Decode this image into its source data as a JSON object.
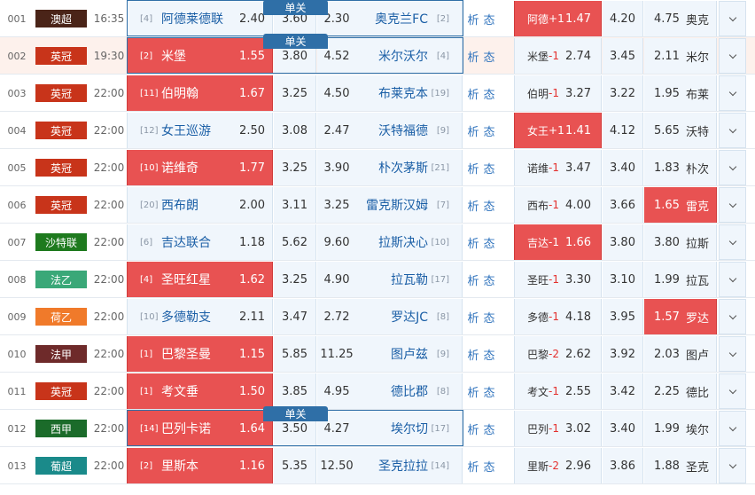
{
  "tag_label": "单关",
  "colors": {
    "highlight": "#e85252",
    "handicap_text": "#e3312f",
    "link": "#2f73bd",
    "team": "#1b5fa6",
    "single_box": "#2f6fa7"
  },
  "rows": [
    {
      "num": "001",
      "league": "澳超",
      "league_color": "#4a2418",
      "time": "16:35",
      "home_rank": "[4]",
      "home": "阿德莱德联",
      "home_odds": "2.40",
      "draw": "3.60",
      "away_odds": "2.30",
      "away": "奥克兰FC",
      "away_rank": "[2]",
      "analysis": "析",
      "state": "态",
      "hc_team": "阿德",
      "hc": "+1",
      "hc_home": "1.47",
      "hc_draw": "4.20",
      "hc_away": "4.75",
      "hc_away_team": "奥克",
      "single": true,
      "row_hl": false,
      "home_red": false,
      "hc_home_red": true,
      "hc_away_red": false
    },
    {
      "num": "002",
      "league": "英冠",
      "league_color": "#c8341a",
      "time": "19:30",
      "home_rank": "[2]",
      "home": "米堡",
      "home_odds": "1.55",
      "draw": "3.80",
      "away_odds": "4.52",
      "away": "米尔沃尔",
      "away_rank": "[4]",
      "analysis": "析",
      "state": "态",
      "hc_team": "米堡",
      "hc": "-1",
      "hc_home": "2.74",
      "hc_draw": "3.45",
      "hc_away": "2.11",
      "hc_away_team": "米尔",
      "single": true,
      "row_hl": true,
      "home_red": true,
      "hc_home_red": false,
      "hc_away_red": false
    },
    {
      "num": "003",
      "league": "英冠",
      "league_color": "#c8341a",
      "time": "22:00",
      "home_rank": "[11]",
      "home": "伯明翰",
      "home_odds": "1.67",
      "draw": "3.25",
      "away_odds": "4.50",
      "away": "布莱克本",
      "away_rank": "[19]",
      "analysis": "析",
      "state": "态",
      "hc_team": "伯明",
      "hc": "-1",
      "hc_home": "3.27",
      "hc_draw": "3.22",
      "hc_away": "1.95",
      "hc_away_team": "布莱",
      "single": false,
      "row_hl": false,
      "home_red": true,
      "hc_home_red": false,
      "hc_away_red": false
    },
    {
      "num": "004",
      "league": "英冠",
      "league_color": "#c8341a",
      "time": "22:00",
      "home_rank": "[12]",
      "home": "女王巡游",
      "home_odds": "2.50",
      "draw": "3.08",
      "away_odds": "2.47",
      "away": "沃特福德",
      "away_rank": "[9]",
      "analysis": "析",
      "state": "态",
      "hc_team": "女王",
      "hc": "+1",
      "hc_home": "1.41",
      "hc_draw": "4.12",
      "hc_away": "5.65",
      "hc_away_team": "沃特",
      "single": false,
      "row_hl": false,
      "home_red": false,
      "hc_home_red": true,
      "hc_away_red": false
    },
    {
      "num": "005",
      "league": "英冠",
      "league_color": "#c8341a",
      "time": "22:00",
      "home_rank": "[10]",
      "home": "诺维奇",
      "home_odds": "1.77",
      "draw": "3.25",
      "away_odds": "3.90",
      "away": "朴次茅斯",
      "away_rank": "[21]",
      "analysis": "析",
      "state": "态",
      "hc_team": "诺维",
      "hc": "-1",
      "hc_home": "3.47",
      "hc_draw": "3.40",
      "hc_away": "1.83",
      "hc_away_team": "朴次",
      "single": false,
      "row_hl": false,
      "home_red": true,
      "hc_home_red": false,
      "hc_away_red": false
    },
    {
      "num": "006",
      "league": "英冠",
      "league_color": "#c8341a",
      "time": "22:00",
      "home_rank": "[20]",
      "home": "西布朗",
      "home_odds": "2.00",
      "draw": "3.11",
      "away_odds": "3.25",
      "away": "雷克斯汉姆",
      "away_rank": "[7]",
      "analysis": "析",
      "state": "态",
      "hc_team": "西布",
      "hc": "-1",
      "hc_home": "4.00",
      "hc_draw": "3.66",
      "hc_away": "1.65",
      "hc_away_team": "雷克",
      "single": false,
      "row_hl": false,
      "home_red": false,
      "hc_home_red": false,
      "hc_away_red": true
    },
    {
      "num": "007",
      "league": "沙特联",
      "league_color": "#1e7a1e",
      "time": "22:00",
      "home_rank": "[6]",
      "home": "吉达联合",
      "home_odds": "1.18",
      "draw": "5.62",
      "away_odds": "9.60",
      "away": "拉斯决心",
      "away_rank": "[10]",
      "analysis": "析",
      "state": "态",
      "hc_team": "吉达",
      "hc": "-1",
      "hc_home": "1.66",
      "hc_draw": "3.80",
      "hc_away": "3.80",
      "hc_away_team": "拉斯",
      "single": false,
      "row_hl": false,
      "home_red": false,
      "hc_home_red": true,
      "hc_away_red": false
    },
    {
      "num": "008",
      "league": "法乙",
      "league_color": "#3aa878",
      "time": "22:00",
      "home_rank": "[4]",
      "home": "圣旺红星",
      "home_odds": "1.62",
      "draw": "3.25",
      "away_odds": "4.90",
      "away": "拉瓦勒",
      "away_rank": "[17]",
      "analysis": "析",
      "state": "态",
      "hc_team": "圣旺",
      "hc": "-1",
      "hc_home": "3.30",
      "hc_draw": "3.10",
      "hc_away": "1.99",
      "hc_away_team": "拉瓦",
      "single": false,
      "row_hl": false,
      "home_red": true,
      "hc_home_red": false,
      "hc_away_red": false
    },
    {
      "num": "009",
      "league": "荷乙",
      "league_color": "#f07a2a",
      "time": "22:00",
      "home_rank": "[10]",
      "home": "多德勒支",
      "home_odds": "2.11",
      "draw": "3.47",
      "away_odds": "2.72",
      "away": "罗达JC",
      "away_rank": "[8]",
      "analysis": "析",
      "state": "态",
      "hc_team": "多德",
      "hc": "-1",
      "hc_home": "4.18",
      "hc_draw": "3.95",
      "hc_away": "1.57",
      "hc_away_team": "罗达",
      "single": false,
      "row_hl": false,
      "home_red": false,
      "hc_home_red": false,
      "hc_away_red": true
    },
    {
      "num": "010",
      "league": "法甲",
      "league_color": "#6e2a2a",
      "time": "22:00",
      "home_rank": "[1]",
      "home": "巴黎圣曼",
      "home_odds": "1.15",
      "draw": "5.85",
      "away_odds": "11.25",
      "away": "图卢兹",
      "away_rank": "[9]",
      "analysis": "析",
      "state": "态",
      "hc_team": "巴黎",
      "hc": "-2",
      "hc_home": "2.62",
      "hc_draw": "3.92",
      "hc_away": "2.03",
      "hc_away_team": "图卢",
      "single": false,
      "row_hl": false,
      "home_red": true,
      "hc_home_red": false,
      "hc_away_red": false
    },
    {
      "num": "011",
      "league": "英冠",
      "league_color": "#c8341a",
      "time": "22:00",
      "home_rank": "[1]",
      "home": "考文垂",
      "home_odds": "1.50",
      "draw": "3.85",
      "away_odds": "4.95",
      "away": "德比郡",
      "away_rank": "[8]",
      "analysis": "析",
      "state": "态",
      "hc_team": "考文",
      "hc": "-1",
      "hc_home": "2.55",
      "hc_draw": "3.42",
      "hc_away": "2.25",
      "hc_away_team": "德比",
      "single": false,
      "row_hl": false,
      "home_red": true,
      "hc_home_red": false,
      "hc_away_red": false
    },
    {
      "num": "012",
      "league": "西甲",
      "league_color": "#1b6b2a",
      "time": "22:00",
      "home_rank": "[14]",
      "home": "巴列卡诺",
      "home_odds": "1.64",
      "draw": "3.50",
      "away_odds": "4.27",
      "away": "埃尔切",
      "away_rank": "[17]",
      "analysis": "析",
      "state": "态",
      "hc_team": "巴列",
      "hc": "-1",
      "hc_home": "3.02",
      "hc_draw": "3.40",
      "hc_away": "1.99",
      "hc_away_team": "埃尔",
      "single": true,
      "row_hl": false,
      "home_red": true,
      "hc_home_red": false,
      "hc_away_red": false
    },
    {
      "num": "013",
      "league": "葡超",
      "league_color": "#1a8a8a",
      "time": "22:00",
      "home_rank": "[2]",
      "home": "里斯本",
      "home_odds": "1.16",
      "draw": "5.35",
      "away_odds": "12.50",
      "away": "圣克拉拉",
      "away_rank": "[14]",
      "analysis": "析",
      "state": "态",
      "hc_team": "里斯",
      "hc": "-2",
      "hc_home": "2.96",
      "hc_draw": "3.86",
      "hc_away": "1.88",
      "hc_away_team": "圣克",
      "single": false,
      "row_hl": false,
      "home_red": true,
      "hc_home_red": false,
      "hc_away_red": false
    }
  ]
}
